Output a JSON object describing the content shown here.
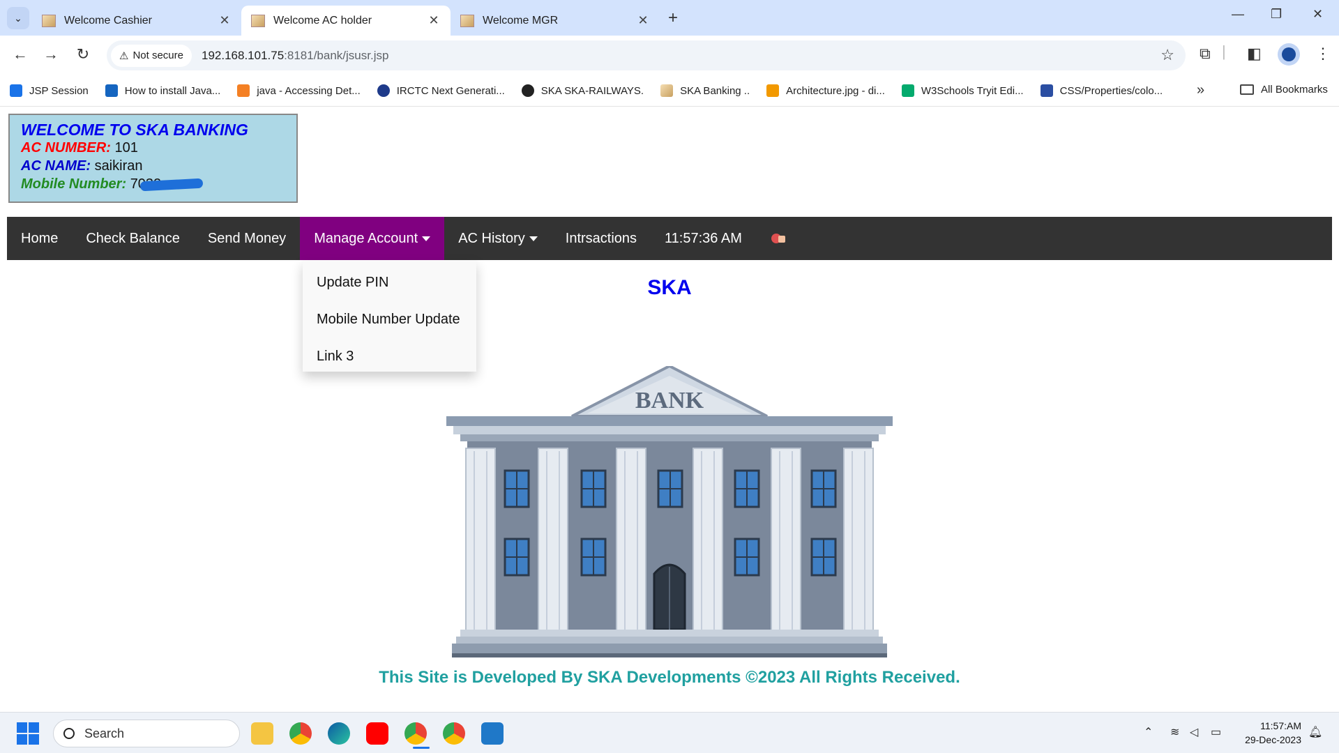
{
  "browser": {
    "tabs": [
      {
        "label": "Welcome Cashier",
        "active": false
      },
      {
        "label": "Welcome AC holder",
        "active": true
      },
      {
        "label": "Welcome MGR",
        "active": false
      }
    ],
    "security_chip": "Not secure",
    "url_host": "192.168.101.75",
    "url_path": ":8181/bank/jsusr.jsp",
    "bookmarks": [
      {
        "label": "JSP Session",
        "icon_color": "#1a73e8"
      },
      {
        "label": "How to install Java...",
        "icon_color": "#1565c0"
      },
      {
        "label": "java - Accessing Det...",
        "icon_color": "#f48024"
      },
      {
        "label": "IRCTC Next Generati...",
        "icon_color": "#1e3a8a"
      },
      {
        "label": "SKA SKA-RAILWAYS.",
        "icon_color": "#222222"
      },
      {
        "label": "SKA Banking ..",
        "icon_color": "#c8a060"
      },
      {
        "label": "Architecture.jpg - di...",
        "icon_color": "#f29900"
      },
      {
        "label": "W3Schools Tryit Edi...",
        "icon_color": "#04aa6d"
      },
      {
        "label": "CSS/Properties/colo...",
        "icon_color": "#2b4ea2"
      }
    ],
    "all_bookmarks": "All Bookmarks"
  },
  "account": {
    "welcome_title": "WELCOME TO SKA BANKING",
    "ac_number_label": "AC NUMBER:",
    "ac_number": "101",
    "ac_name_label": "AC NAME:",
    "ac_name": "saikiran",
    "mobile_label": "Mobile Number:",
    "mobile_visible": "7032"
  },
  "nav": {
    "home": "Home",
    "check_balance": "Check Balance",
    "send_money": "Send Money",
    "manage_account": "Manage Account",
    "ac_history": "AC History",
    "intrsactions": "Intrsactions",
    "time": "11:57:36 AM"
  },
  "dropdown": {
    "items": [
      "Update PIN",
      "Mobile Number Update",
      "Link 3"
    ]
  },
  "main": {
    "heading": "SKA",
    "bank_sign": "BANK"
  },
  "footer": {
    "text": "This Site is Developed By SKA Developments ©2023 All Rights Received."
  },
  "taskbar": {
    "search_placeholder": "Search",
    "time": "11:57:AM",
    "date": "29-Dec-2023"
  },
  "colors": {
    "nav_bg": "#333333",
    "nav_active": "#800080",
    "welcome_bg": "#add8e6",
    "heading_blue": "#0000ee",
    "footer_teal": "#20a0a0"
  }
}
